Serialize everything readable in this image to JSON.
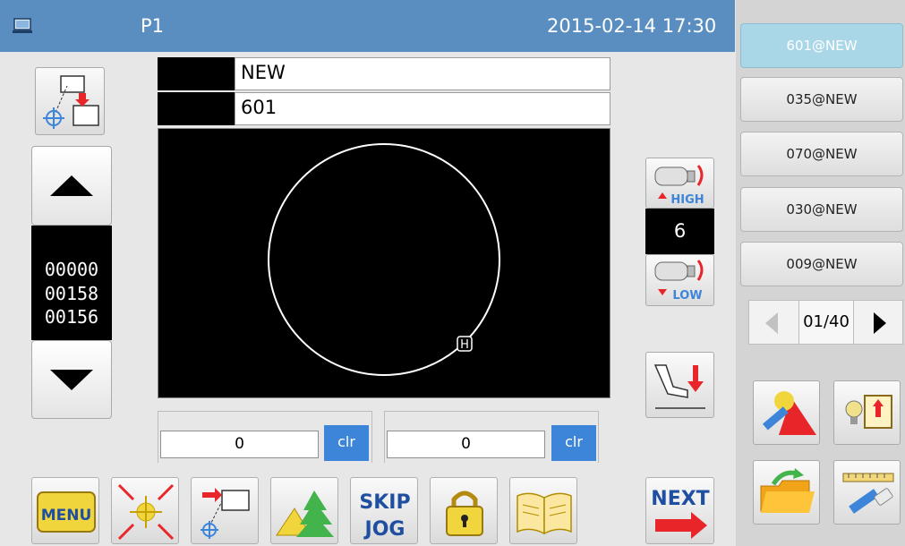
{
  "header": {
    "title": "P1",
    "datetime": "2015-02-14 17:30",
    "color": "#5a8ec0"
  },
  "pattern": {
    "name": "NEW",
    "number": "601"
  },
  "coordinates": {
    "lines": [
      "00000",
      "00158",
      "00156"
    ]
  },
  "speed": {
    "value": "6",
    "high_label": "HIGH",
    "low_label": "LOW"
  },
  "counters": [
    {
      "value": "0",
      "clear_label": "clr"
    },
    {
      "value": "0",
      "clear_label": "clr"
    }
  ],
  "canvas": {
    "home_marker": "H"
  },
  "file_list": {
    "items": [
      "601@NEW",
      "035@NEW",
      "070@NEW",
      "030@NEW",
      "009@NEW"
    ],
    "selected_index": 0,
    "page": "01/40"
  },
  "toolbar": {
    "menu_label": "MENU",
    "skip_label": "SKIP",
    "jog_label": "JOG",
    "next_label": "NEXT"
  },
  "icons": {
    "accent_red": "#e8262a",
    "accent_blue": "#3d85d9",
    "accent_yellow": "#f0d63c"
  }
}
